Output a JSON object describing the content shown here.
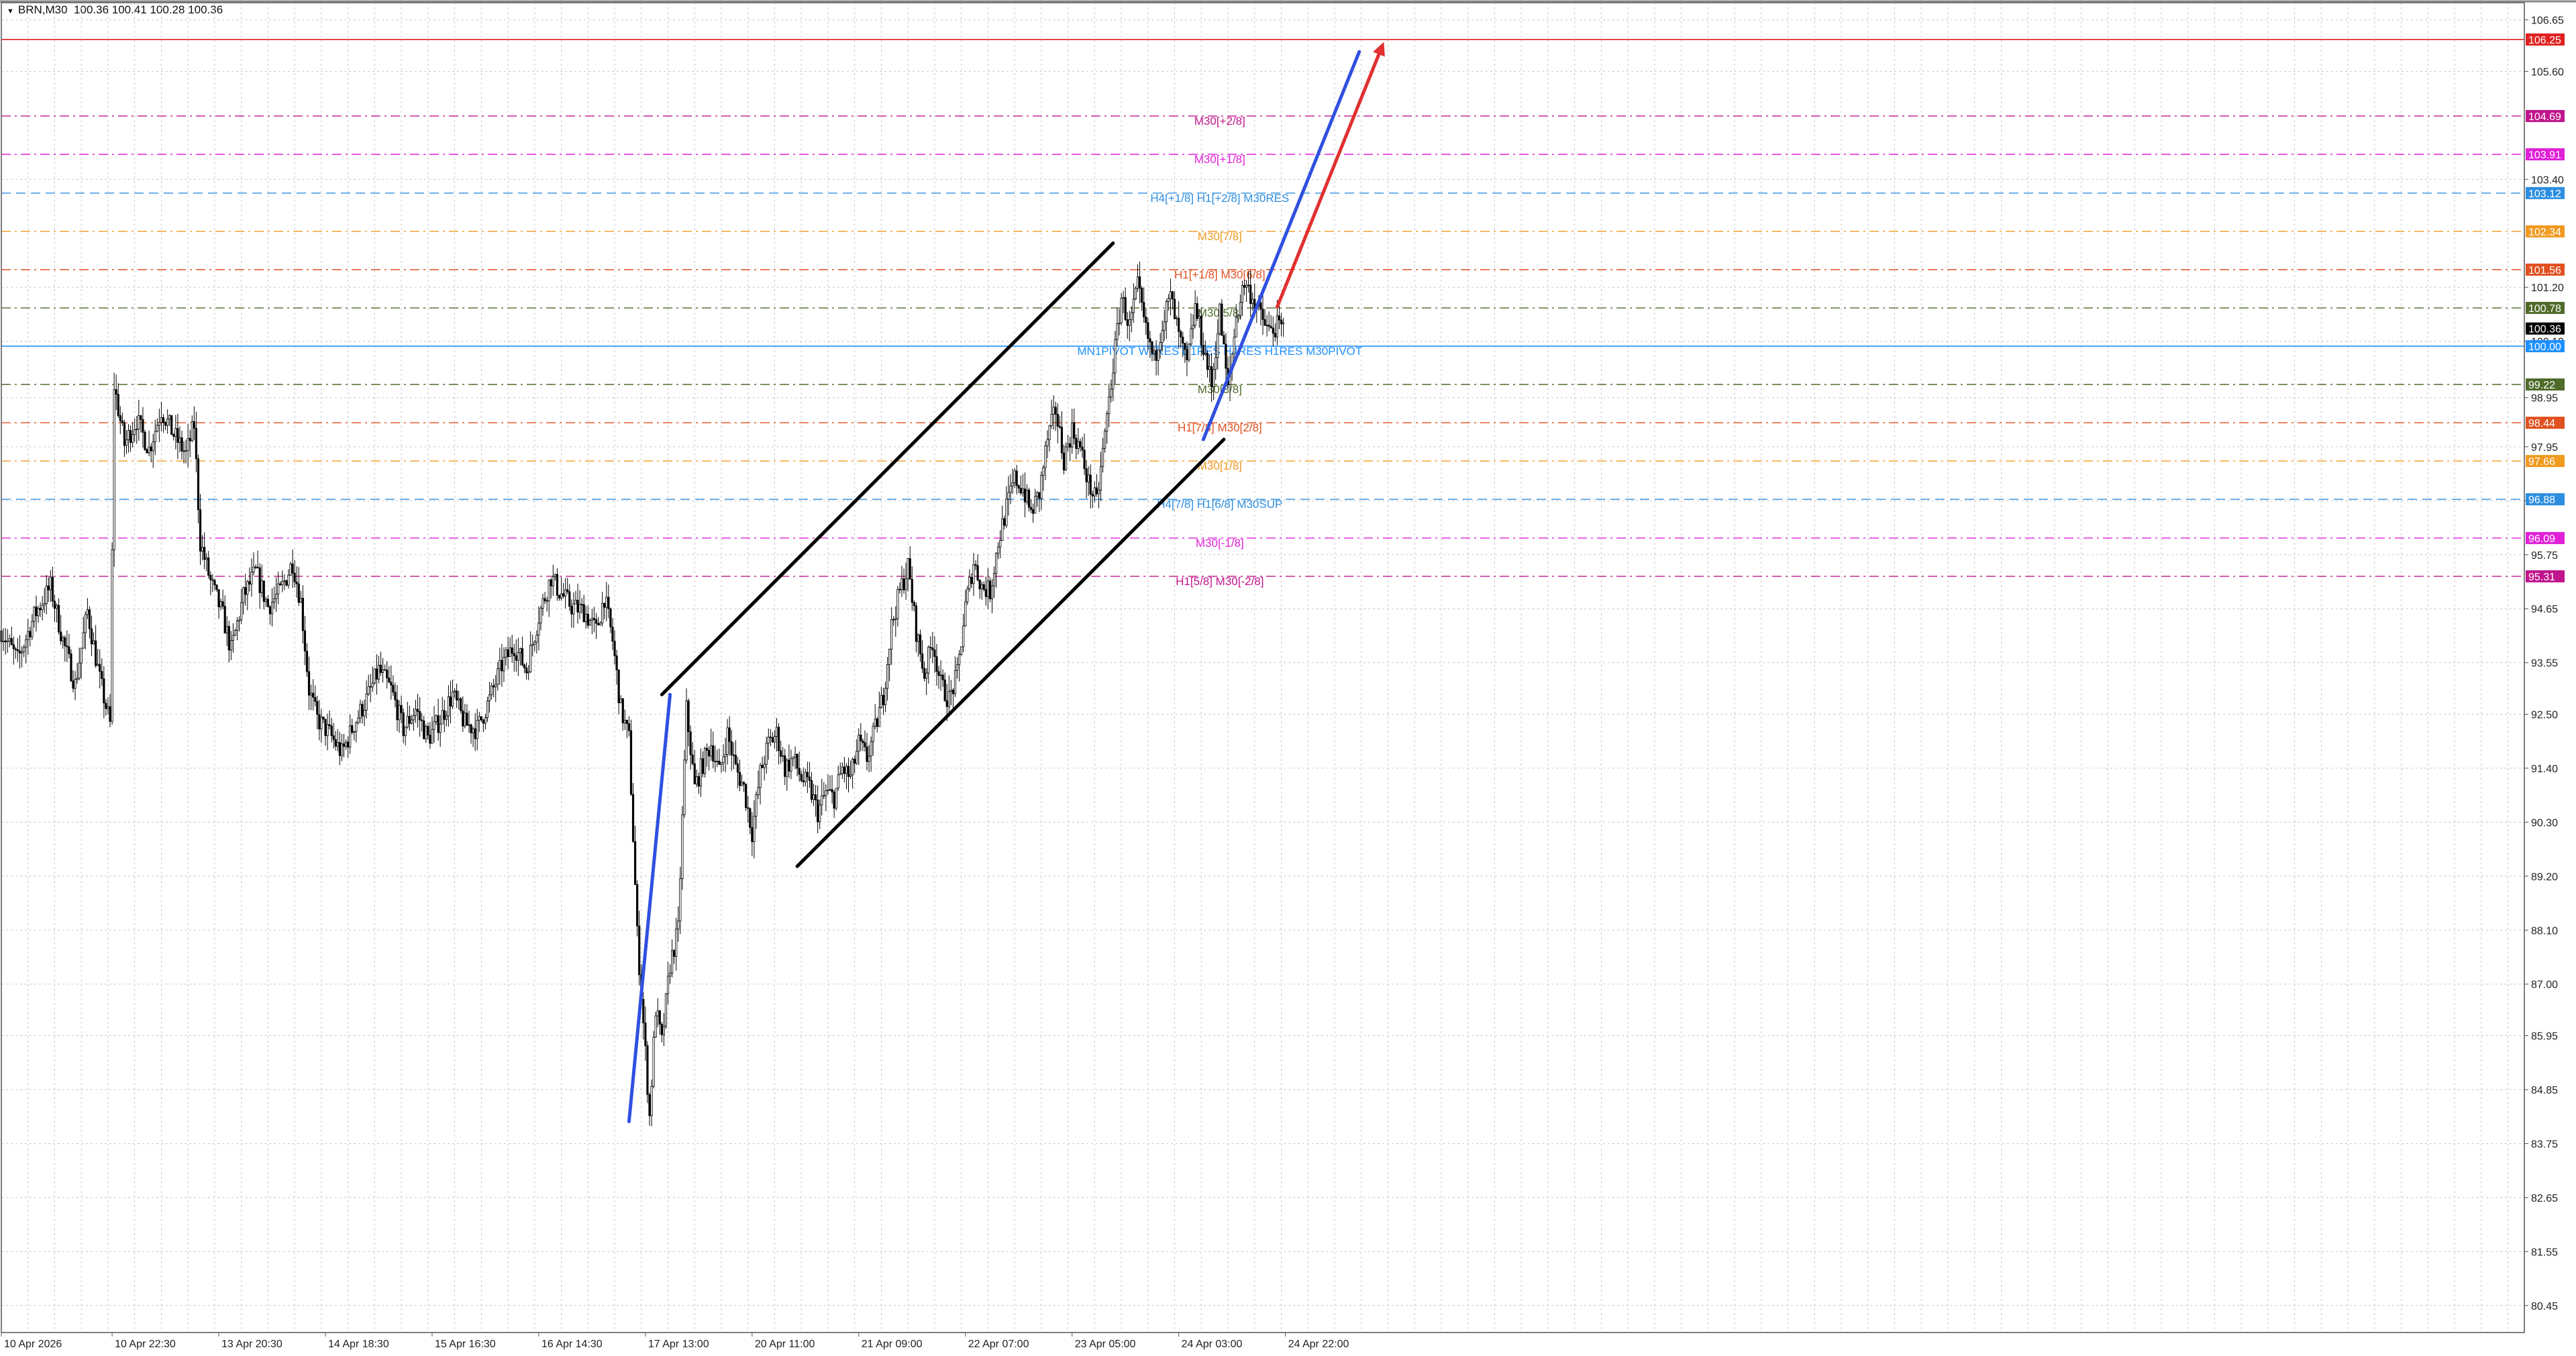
{
  "header": {
    "symbol": "BRN,M30",
    "ohlc": "100.36 100.41 100.28 100.36"
  },
  "colors": {
    "grid": "#c8c8c8",
    "axis": "#555555",
    "candle": "#000000",
    "channel": "#000000",
    "blue_line": "#3050e0",
    "red_arrow": "#e03030",
    "pivot_line": "#1e90ff",
    "top_level": "#e02020"
  },
  "chart_data": {
    "type": "candlestick",
    "instrument": "BRN",
    "timeframe": "M30",
    "ylim": [
      79.9,
      107.0
    ],
    "y_ticks": [
      106.65,
      105.6,
      103.4,
      101.2,
      100.1,
      98.95,
      97.95,
      96.85,
      95.75,
      94.65,
      93.55,
      92.5,
      91.4,
      90.3,
      89.2,
      88.1,
      87.0,
      85.95,
      84.85,
      83.75,
      82.65,
      81.55,
      80.45
    ],
    "x_range": [
      0,
      1230
    ],
    "x_labels": [
      {
        "t": 0,
        "label": "10 Apr 2026"
      },
      {
        "t": 54,
        "label": "10 Apr 22:30"
      },
      {
        "t": 106,
        "label": "13 Apr 20:30"
      },
      {
        "t": 158,
        "label": "14 Apr 18:30"
      },
      {
        "t": 210,
        "label": "15 Apr 16:30"
      },
      {
        "t": 262,
        "label": "16 Apr 14:30"
      },
      {
        "t": 314,
        "label": "17 Apr 13:00"
      },
      {
        "t": 366,
        "label": "20 Apr 11:00"
      },
      {
        "t": 418,
        "label": "21 Apr 09:00"
      },
      {
        "t": 470,
        "label": "22 Apr 07:00"
      },
      {
        "t": 522,
        "label": "23 Apr 05:00"
      },
      {
        "t": 574,
        "label": "24 Apr 03:00"
      },
      {
        "t": 626,
        "label": "24 Apr 22:00"
      }
    ],
    "price_path": [
      [
        0,
        94.2
      ],
      [
        8,
        93.6
      ],
      [
        16,
        94.5
      ],
      [
        24,
        95.1
      ],
      [
        30,
        94.0
      ],
      [
        36,
        93.1
      ],
      [
        42,
        94.6
      ],
      [
        48,
        93.2
      ],
      [
        53,
        92.3
      ],
      [
        55,
        99.2
      ],
      [
        60,
        98.0
      ],
      [
        66,
        98.5
      ],
      [
        72,
        97.9
      ],
      [
        78,
        98.7
      ],
      [
        84,
        98.2
      ],
      [
        90,
        97.8
      ],
      [
        94,
        98.4
      ],
      [
        97,
        96.0
      ],
      [
        102,
        95.2
      ],
      [
        108,
        94.5
      ],
      [
        112,
        93.8
      ],
      [
        118,
        94.9
      ],
      [
        124,
        95.4
      ],
      [
        130,
        94.7
      ],
      [
        136,
        95.0
      ],
      [
        142,
        95.6
      ],
      [
        146,
        94.8
      ],
      [
        150,
        93.0
      ],
      [
        154,
        92.4
      ],
      [
        160,
        92.1
      ],
      [
        166,
        91.7
      ],
      [
        172,
        92.3
      ],
      [
        178,
        92.8
      ],
      [
        184,
        93.4
      ],
      [
        190,
        93.0
      ],
      [
        196,
        92.2
      ],
      [
        202,
        92.6
      ],
      [
        208,
        92.0
      ],
      [
        214,
        92.4
      ],
      [
        220,
        92.9
      ],
      [
        226,
        92.3
      ],
      [
        232,
        92.2
      ],
      [
        238,
        92.8
      ],
      [
        244,
        93.5
      ],
      [
        250,
        93.9
      ],
      [
        256,
        93.4
      ],
      [
        262,
        94.5
      ],
      [
        268,
        95.3
      ],
      [
        272,
        95.0
      ],
      [
        278,
        94.7
      ],
      [
        284,
        94.6
      ],
      [
        290,
        94.2
      ],
      [
        294,
        94.9
      ],
      [
        298,
        94.0
      ],
      [
        302,
        92.6
      ],
      [
        306,
        92.0
      ],
      [
        310,
        88.0
      ],
      [
        314,
        85.6
      ],
      [
        316,
        84.3
      ],
      [
        319,
        86.5
      ],
      [
        322,
        85.8
      ],
      [
        326,
        87.4
      ],
      [
        330,
        88.1
      ],
      [
        334,
        92.6
      ],
      [
        338,
        91.0
      ],
      [
        342,
        91.5
      ],
      [
        346,
        91.9
      ],
      [
        350,
        91.3
      ],
      [
        354,
        92.1
      ],
      [
        358,
        91.4
      ],
      [
        362,
        91.0
      ],
      [
        366,
        90.1
      ],
      [
        370,
        91.3
      ],
      [
        374,
        91.9
      ],
      [
        378,
        92.1
      ],
      [
        382,
        91.4
      ],
      [
        386,
        91.6
      ],
      [
        390,
        91.2
      ],
      [
        394,
        91.0
      ],
      [
        398,
        90.5
      ],
      [
        402,
        90.9
      ],
      [
        406,
        90.8
      ],
      [
        410,
        91.4
      ],
      [
        414,
        91.2
      ],
      [
        418,
        91.9
      ],
      [
        422,
        91.6
      ],
      [
        426,
        92.2
      ],
      [
        430,
        92.9
      ],
      [
        434,
        94.3
      ],
      [
        438,
        95.0
      ],
      [
        442,
        95.5
      ],
      [
        446,
        94.2
      ],
      [
        450,
        93.3
      ],
      [
        454,
        94.0
      ],
      [
        458,
        93.1
      ],
      [
        462,
        92.8
      ],
      [
        466,
        93.3
      ],
      [
        470,
        94.7
      ],
      [
        474,
        95.6
      ],
      [
        478,
        95.1
      ],
      [
        482,
        95.0
      ],
      [
        486,
        96.0
      ],
      [
        490,
        96.7
      ],
      [
        494,
        97.3
      ],
      [
        498,
        97.1
      ],
      [
        502,
        96.6
      ],
      [
        506,
        97.0
      ],
      [
        510,
        98.1
      ],
      [
        514,
        98.7
      ],
      [
        518,
        97.7
      ],
      [
        522,
        98.3
      ],
      [
        526,
        97.9
      ],
      [
        530,
        97.2
      ],
      [
        534,
        96.8
      ],
      [
        538,
        98.2
      ],
      [
        542,
        99.6
      ],
      [
        546,
        101.0
      ],
      [
        550,
        100.4
      ],
      [
        554,
        101.2
      ],
      [
        558,
        100.3
      ],
      [
        562,
        99.7
      ],
      [
        566,
        100.5
      ],
      [
        570,
        101.0
      ],
      [
        574,
        100.2
      ],
      [
        578,
        99.6
      ],
      [
        582,
        100.8
      ],
      [
        586,
        100.0
      ],
      [
        590,
        99.2
      ],
      [
        594,
        100.7
      ],
      [
        598,
        99.1
      ],
      [
        602,
        100.6
      ],
      [
        606,
        101.3
      ],
      [
        610,
        101.0
      ],
      [
        614,
        100.6
      ],
      [
        618,
        100.3
      ],
      [
        622,
        100.4
      ],
      [
        625,
        100.36
      ]
    ],
    "levels": [
      {
        "price": 106.25,
        "label": "",
        "tag": "106.25",
        "color": "#e02020",
        "style": "solid"
      },
      {
        "price": 104.69,
        "label": "M30[+2/8]",
        "tag": "104.69",
        "color": "#c0158c",
        "style": "dashdot"
      },
      {
        "price": 103.91,
        "label": "M30[+1/8]",
        "tag": "103.91",
        "color": "#e020d8",
        "style": "dashdot"
      },
      {
        "price": 103.12,
        "label": "H4[+1/8] H1[+2/8] M30RES",
        "tag": "103.12",
        "color": "#2d8ee0",
        "style": "dash"
      },
      {
        "price": 102.34,
        "label": "M30[7/8]",
        "tag": "102.34",
        "color": "#f09a20",
        "style": "dashdot"
      },
      {
        "price": 101.56,
        "label": "H1[+1/8] M30[6/8]",
        "tag": "101.56",
        "color": "#e05020",
        "style": "dashdot"
      },
      {
        "price": 100.78,
        "label": "M30[5/8]",
        "tag": "100.78",
        "color": "#4f6b2a",
        "style": "dashdot"
      },
      {
        "price": 100.36,
        "label": "",
        "tag": "100.36",
        "color": "#000000",
        "style": "none"
      },
      {
        "price": 100.0,
        "label": "MN1PIVOT W1RES D1RES H4RES H1RES M30PIVOT",
        "tag": "100.00",
        "color": "#1e90ff",
        "style": "solid"
      },
      {
        "price": 99.22,
        "label": "M30[3/8]",
        "tag": "99.22",
        "color": "#4f6b2a",
        "style": "dashdot"
      },
      {
        "price": 98.44,
        "label": "H1[7/8] M30[2/8]",
        "tag": "98.44",
        "color": "#e05020",
        "style": "dashdot"
      },
      {
        "price": 97.66,
        "label": "M30[1/8]",
        "tag": "97.66",
        "color": "#f09a20",
        "style": "dashdot"
      },
      {
        "price": 96.88,
        "label": "H4[7/8] H1[6/8] M30SUP",
        "tag": "96.88",
        "color": "#2d8ee0",
        "style": "dash"
      },
      {
        "price": 96.09,
        "label": "M30[-1/8]",
        "tag": "96.09",
        "color": "#e020d8",
        "style": "dashdot"
      },
      {
        "price": 95.31,
        "label": "H1[5/8] M30[-2/8]",
        "tag": "95.31",
        "color": "#c0158c",
        "style": "dashdot"
      }
    ],
    "trendlines": [
      {
        "name": "channel-upper",
        "color": "#000000",
        "points": [
          [
            322,
            92.9
          ],
          [
            542,
            102.1
          ]
        ]
      },
      {
        "name": "channel-lower",
        "color": "#000000",
        "points": [
          [
            388,
            89.4
          ],
          [
            596,
            98.1
          ]
        ]
      },
      {
        "name": "impulse-line-1",
        "color": "#3050e0",
        "points": [
          [
            306,
            84.2
          ],
          [
            326,
            92.9
          ]
        ]
      },
      {
        "name": "impulse-line-2",
        "color": "#3050e0",
        "points": [
          [
            586,
            98.1
          ],
          [
            662,
            106.0
          ]
        ]
      }
    ],
    "arrows": [
      {
        "name": "forecast-arrow",
        "color": "#e03030",
        "points": [
          [
            622,
            100.8
          ],
          [
            674,
            106.2
          ]
        ]
      }
    ],
    "grid": true
  }
}
